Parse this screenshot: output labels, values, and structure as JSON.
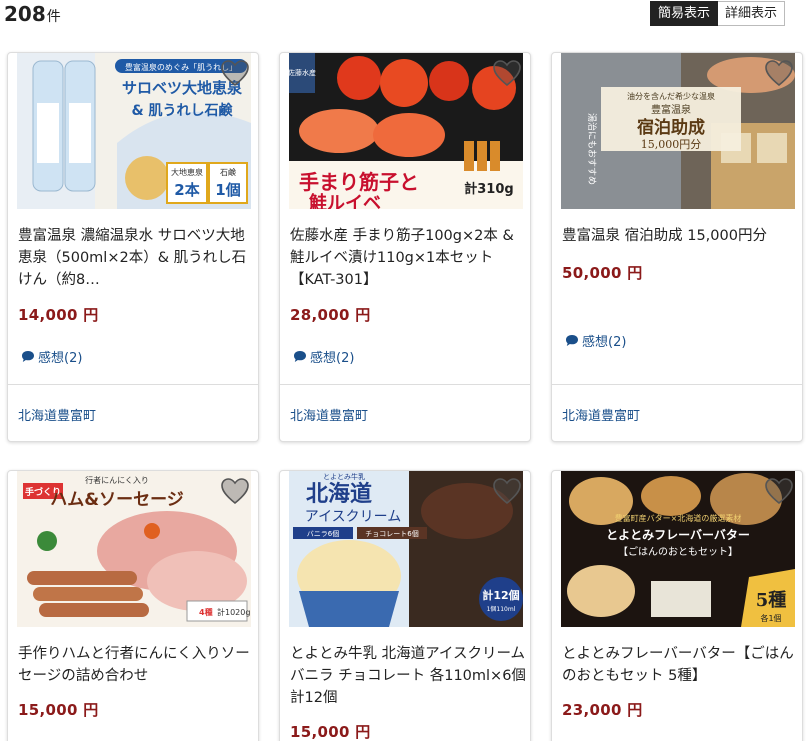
{
  "header": {
    "count": "208",
    "count_unit": "件",
    "view_simple": "簡易表示",
    "view_detail": "詳細表示"
  },
  "products": [
    {
      "title": "豊富温泉 濃縮温泉水 サロベツ大地恵泉（500ml×2本）& 肌うれし石けん（約8…",
      "price": "14,000 円",
      "review": "感想(2)",
      "region": "北海道豊富町",
      "image_text": {
        "banner": "サロベツ大地恵泉",
        "sub": "& 肌うれし石鹸",
        "tag1": "大地恵泉",
        "tag1_num": "2本",
        "tag2": "石鹸",
        "tag2_num": "1個",
        "top": "豊富温泉のめぐみ「肌うれし」"
      }
    },
    {
      "title": "佐藤水産 手まり筋子100g×2本 & 鮭ルイベ漬け110g×1本セット【KAT-301】",
      "price": "28,000 円",
      "review": "感想(2)",
      "region": "北海道豊富町",
      "image_text": {
        "main": "手まり筋子と",
        "main2": "鮭ルイベ",
        "weight": "計310g",
        "logo": "佐藤水産"
      }
    },
    {
      "title": "豊富温泉 宿泊助成 15,000円分",
      "price": "50,000 円",
      "review": "感想(2)",
      "region": "北海道豊富町",
      "image_text": {
        "small": "油分を含んだ希少な温泉",
        "name": "豊富温泉",
        "main": "宿泊助成",
        "amount": "15,000円分",
        "side": "湯治にもおすすめ"
      }
    },
    {
      "title": "手作りハムと行者にんにく入りソーセージの詰め合わせ",
      "price": "15,000 円",
      "review": "",
      "region": "",
      "image_text": {
        "tag": "手づくり",
        "main": "ハム&ソーセージ",
        "top": "行者にんにく入り",
        "weight": "計1020g",
        "kinds": "4種"
      }
    },
    {
      "title": "とよとみ牛乳 北海道アイスクリーム バニラ チョコレート 各110ml×6個 計12個",
      "price": "15,000 円",
      "review": "",
      "region": "",
      "image_text": {
        "brand": "とよとみ牛乳",
        "main": "北海道",
        "main2": "アイスクリーム",
        "v1": "バニラ6個",
        "v2": "チョコレート6個",
        "count": "計12個",
        "unit": "1個110ml"
      }
    },
    {
      "title": "とよとみフレーバーバター【ごはんのおともセット 5種】",
      "price": "23,000 円",
      "review": "",
      "region": "",
      "image_text": {
        "top": "豊富町産バター×北海道の厳選素材",
        "main": "とよとみフレーバーバター",
        "sub": "【ごはんのおともセット】",
        "kinds": "5種",
        "each": "各1個"
      }
    }
  ],
  "colors": {
    "price": "#8b1a1a",
    "link": "#1a4f8a",
    "active_toggle": "#222222"
  },
  "icons": [
    "heart-icon",
    "speech-bubble-icon"
  ]
}
